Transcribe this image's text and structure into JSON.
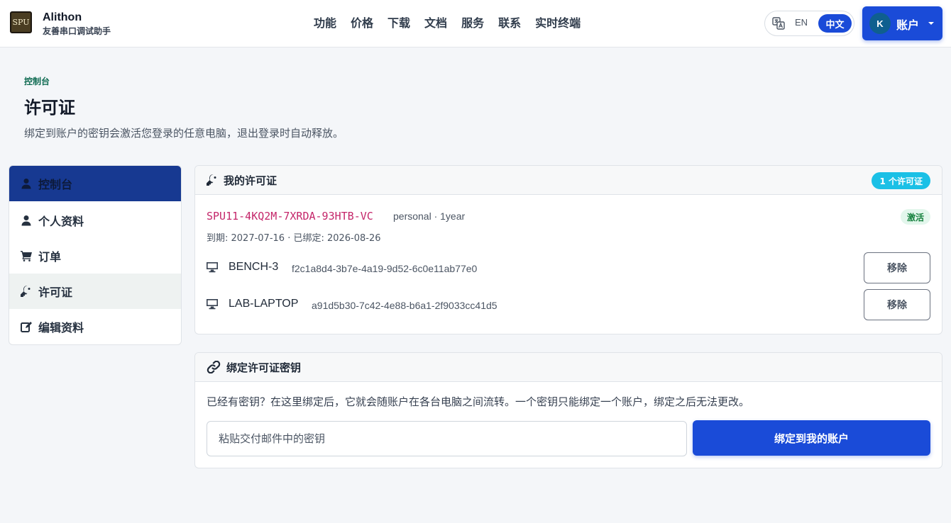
{
  "brand": {
    "logo_text": "SPU",
    "name": "Alithon",
    "subtitle": "友善串口调试助手"
  },
  "nav": {
    "items": [
      "功能",
      "价格",
      "下载",
      "文档",
      "服务",
      "联系",
      "实时终端"
    ]
  },
  "lang": {
    "icon": "translate-icon",
    "en": "EN",
    "zh": "中文",
    "selected": "中文"
  },
  "account": {
    "avatar_initial": "K",
    "label": "账户"
  },
  "page": {
    "breadcrumb": "控制台",
    "title": "许可证",
    "description": "绑定到账户的密钥会激活您登录的任意电脑，退出登录时自动释放。"
  },
  "sidebar": {
    "items": [
      {
        "label": "控制台",
        "icon": "user-icon"
      },
      {
        "label": "个人资料",
        "icon": "user-icon"
      },
      {
        "label": "订单",
        "icon": "cart-icon"
      },
      {
        "label": "许可证",
        "icon": "key-icon"
      },
      {
        "label": "编辑资料",
        "icon": "edit-icon"
      }
    ]
  },
  "licenses_card": {
    "title": "我的许可证",
    "count_badge": "1 个许可证",
    "license": {
      "key": "SPU11-4KQ2M-7XRDA-93HTB-VC",
      "meta": "personal · 1year",
      "dates": "到期: 2027-07-16 · 已绑定: 2026-08-26",
      "status": "激活"
    },
    "devices": [
      {
        "name": "BENCH-3",
        "id": "f2c1a8d4-3b7e-4a19-9d52-6c0e11ab77e0",
        "remove_label": "移除"
      },
      {
        "name": "LAB-LAPTOP",
        "id": "a91d5b30-7c42-4e88-b6a1-2f9033cc41d5",
        "remove_label": "移除"
      }
    ]
  },
  "bind_card": {
    "title": "绑定许可证密钥",
    "description": "已经有密钥？在这里绑定后，它就会随账户在各台电脑之间流转。一个密钥只能绑定一个账户，绑定之后无法更改。",
    "input_placeholder": "粘贴交付邮件中的密钥",
    "input_value": "",
    "button_label": "绑定到我的账户"
  },
  "colors": {
    "primary": "#1a4bd8",
    "sidebar_active": "#173991",
    "license_key": "#c4266a",
    "badge_info": "#1bc0e6",
    "status_active_bg": "#e3f6ec",
    "status_active_text": "#15803d",
    "breadcrumb": "#0f6b52"
  }
}
